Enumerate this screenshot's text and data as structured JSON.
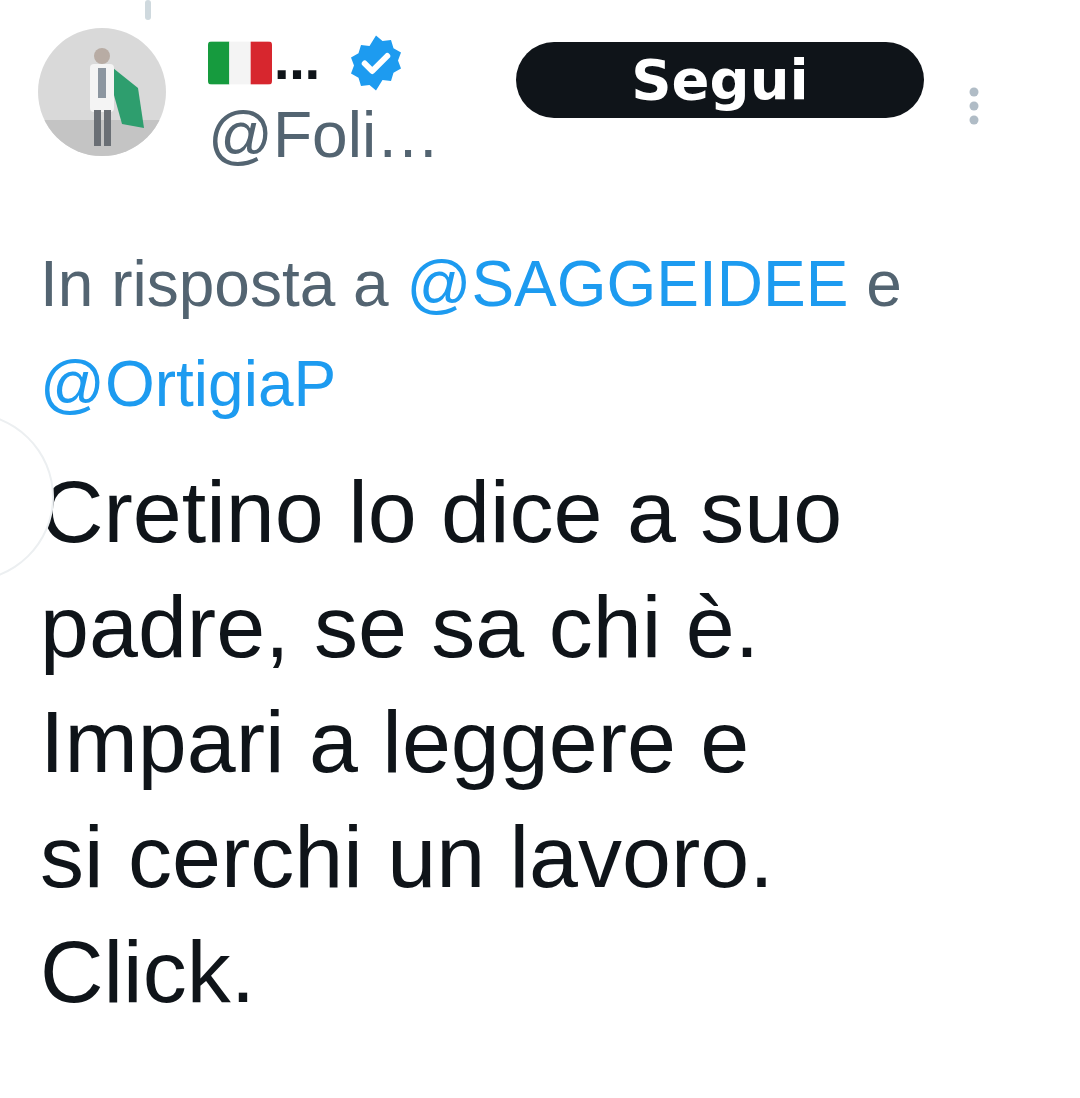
{
  "author": {
    "display_name": "…",
    "handle": "@Foli…",
    "verified": true
  },
  "follow_button": "Segui",
  "reply_to": {
    "prefix": "In risposta a",
    "mentions": [
      "@SAGGEIDEE",
      "@OrtigiaP"
    ],
    "joiner": "e"
  },
  "text": "Cretino lo dice a suo\npadre, se sa chi è.\nImpari a leggere e\nsi cerchi un lavoro.\nClick."
}
